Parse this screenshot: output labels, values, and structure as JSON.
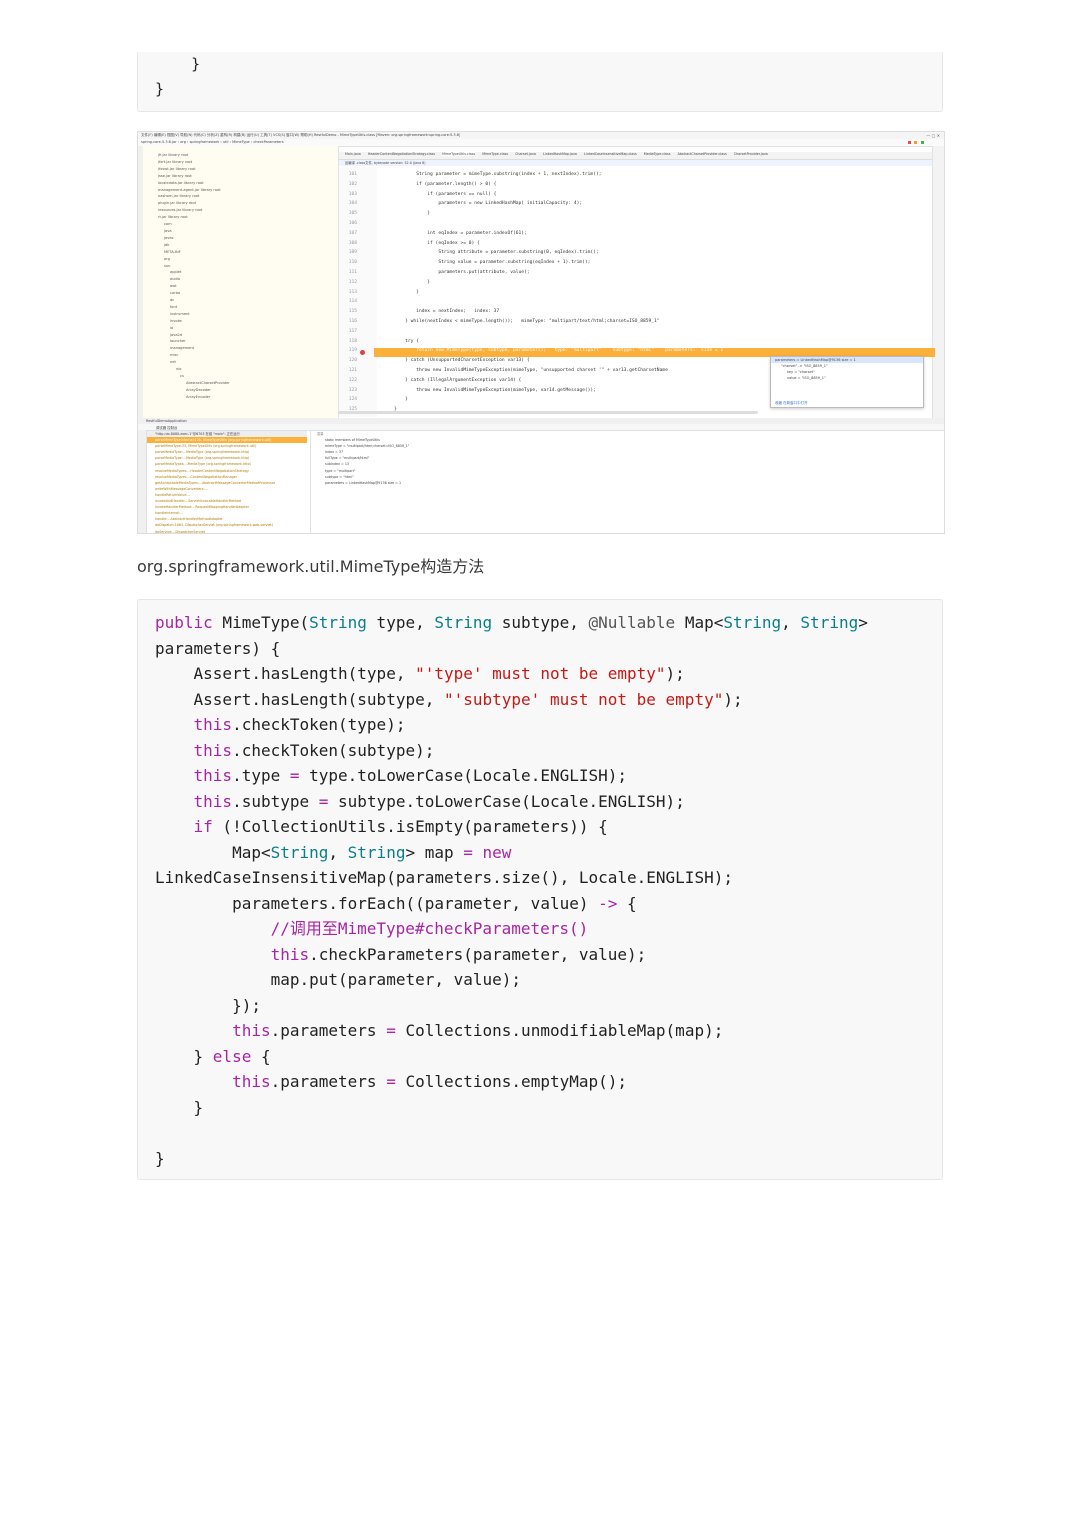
{
  "top_code": {
    "lines": [
      "    }",
      "}"
    ]
  },
  "ide": {
    "menu": "文件(F)  编辑(E)  视图(V)  导航(N)  代码(C)  分析(Z)  重构(R)  构建(B)  运行(U)  工具(T)  VCS(S)  窗口(W)  帮助(H)    RestfulDemo - MimeTypeUtils.class [Maven: org.springframework:spring-core:5.3.6]",
    "breadcrumb": "spring-core-5.3.6.jar  ›  org  ›  springframework  ›  util  ›  MimeType  ›  checkParameters",
    "tabs": [
      "Main.java",
      "HeaderContentNegotiationStrategy.class",
      "MimeTypeUtils.class",
      "MimeType.class",
      "Charset.java",
      "LinkedHashMap.java",
      "LinkedCaseInsensitiveMap.class",
      "MediaType.class",
      "AbstractCharsetProvider.class",
      "CharsetProvider.java"
    ],
    "notice": "反编译 .class文件, bytecode version: 52.0 (Java 8)",
    "tree_items": [
      "jfr.jar  library root",
      "jfxrt.jar  library root",
      "jfxswt.jar  library root",
      "jsse.jar  library root",
      "localedata.jar  library root",
      "management-agent.jar  library root",
      "nashorn.jar  library root",
      "plugin.jar  library root",
      "resources.jar  library root",
      "rt.jar  library root",
      "com",
      "java",
      "javax",
      "jdk",
      "META-INF",
      "org",
      "sun",
      "applet",
      "audio",
      "awt",
      "corba",
      "dc",
      "font",
      "instrument",
      "invoke",
      "io",
      "java2d",
      "launcher",
      "management",
      "misc",
      "net",
      "nio",
      "cs",
      "AbstractCharsetProvider",
      "ArrayDecoder",
      "ArrayEncoder"
    ],
    "line_numbers": [
      "101",
      "102",
      "103",
      "104",
      "105",
      "106",
      "107",
      "108",
      "109",
      "110",
      "111",
      "112",
      "113",
      "114",
      "115",
      "116",
      "117",
      "118",
      "119",
      "120",
      "121",
      "122",
      "123",
      "124",
      "125"
    ],
    "code_lines": [
      "            String parameter = mimeType.substring(index + 1, nextIndex).trim();",
      "            if (parameter.length() > 0) {",
      "                if (parameters == null) {",
      "                    parameters = new LinkedHashMap( initialCapacity: 4);",
      "                }",
      "",
      "                int eqIndex = parameter.indexOf(61);",
      "                if (eqIndex >= 0) {",
      "                    String attribute = parameter.substring(0, eqIndex).trim();",
      "                    String value = parameter.substring(eqIndex + 1).trim();",
      "                    parameters.put(attribute, value);",
      "                }",
      "            }",
      "",
      "            index = nextIndex;   index: 37",
      "        } while(nextIndex < mimeType.length());   mimeType: \"multipart/text/html;charset=ISO_8859_1\"",
      "",
      "        try {",
      "            return new MimeType(type, subtype, parameters);   type: \"multipart\"    subtype: \"html\"    parameters:  size = 1",
      "        } catch (UnsupportedCharsetException var13) {",
      "            throw new InvalidMimeTypeException(mimeType, \"unsupported charset '\" + var13.getCharsetName",
      "        } catch (IllegalArgumentException var14) {",
      "            throw new InvalidMimeTypeException(mimeType, var14.getMessage());",
      "        }",
      "    }"
    ],
    "popup_lines": [
      "parameters = LinkedHashMap@9136  size = 1",
      "\"charset\" -> \"ISO_8859_1\"",
      "key = \"charset\"",
      "value = \"ISO_8859_1\""
    ],
    "popup_footer": "收藏     在新窗口中打开",
    "debug_title": "RestfulDemoApplication",
    "debug_tabs": "调试器    控制台",
    "frames_header": "\"http-nio-8080-exec-1\"@6703 在组 \"main\": 正在运行",
    "frames": [
      "parseMimeTypeInternal:120, MimeTypeUtils (org.springframework.util)",
      "parseMimeType:33, MimeTypeUtils (org.springframework.util)",
      "parseMediaType:...MediaType (org.springframework.http)",
      "parseMediaType:...MediaType (org.springframework.http)",
      "parseMediaTypes:...MediaType (org.springframework.http)",
      "resolveMediaTypes:...HeaderContentNegotiationStrategy",
      "resolveMediaTypes:...ContentNegotiationManager",
      "getAcceptableMediaTypes:...AbstractMessageConverterMethodProcessor",
      "writeWithMessageConverters:...",
      "handleReturnValue:...",
      "invokeAndHandle:...ServletInvocableHandlerMethod",
      "invokeHandlerMethod:...RequestMappingHandlerAdapter",
      "handleInternal:...",
      "handle:...AbstractHandlerMethodAdapter",
      "doDispatch:1063, DispatcherServlet (org.springframework.web.servlet)",
      "doService:...DispatcherServlet"
    ],
    "vars_header": "变量",
    "vars": [
      "static members of MimeTypeUtils",
      "mimeType = \"multipart/html;charset=ISO_8859_1\"",
      "index = 37",
      "fullType = \"multipart/html\"",
      "subIndex = 13",
      "type = \"multipart\"",
      "subtype = \"html\"",
      "parameters = LinkedHashMap@9136  size = 1"
    ]
  },
  "caption": "org.springframework.util.MimeType构造方法",
  "colors": {
    "keyword": "#a626a4",
    "type": "#0a7e8c",
    "string": "#c41a16",
    "highlight_line": "#fbb03b"
  }
}
